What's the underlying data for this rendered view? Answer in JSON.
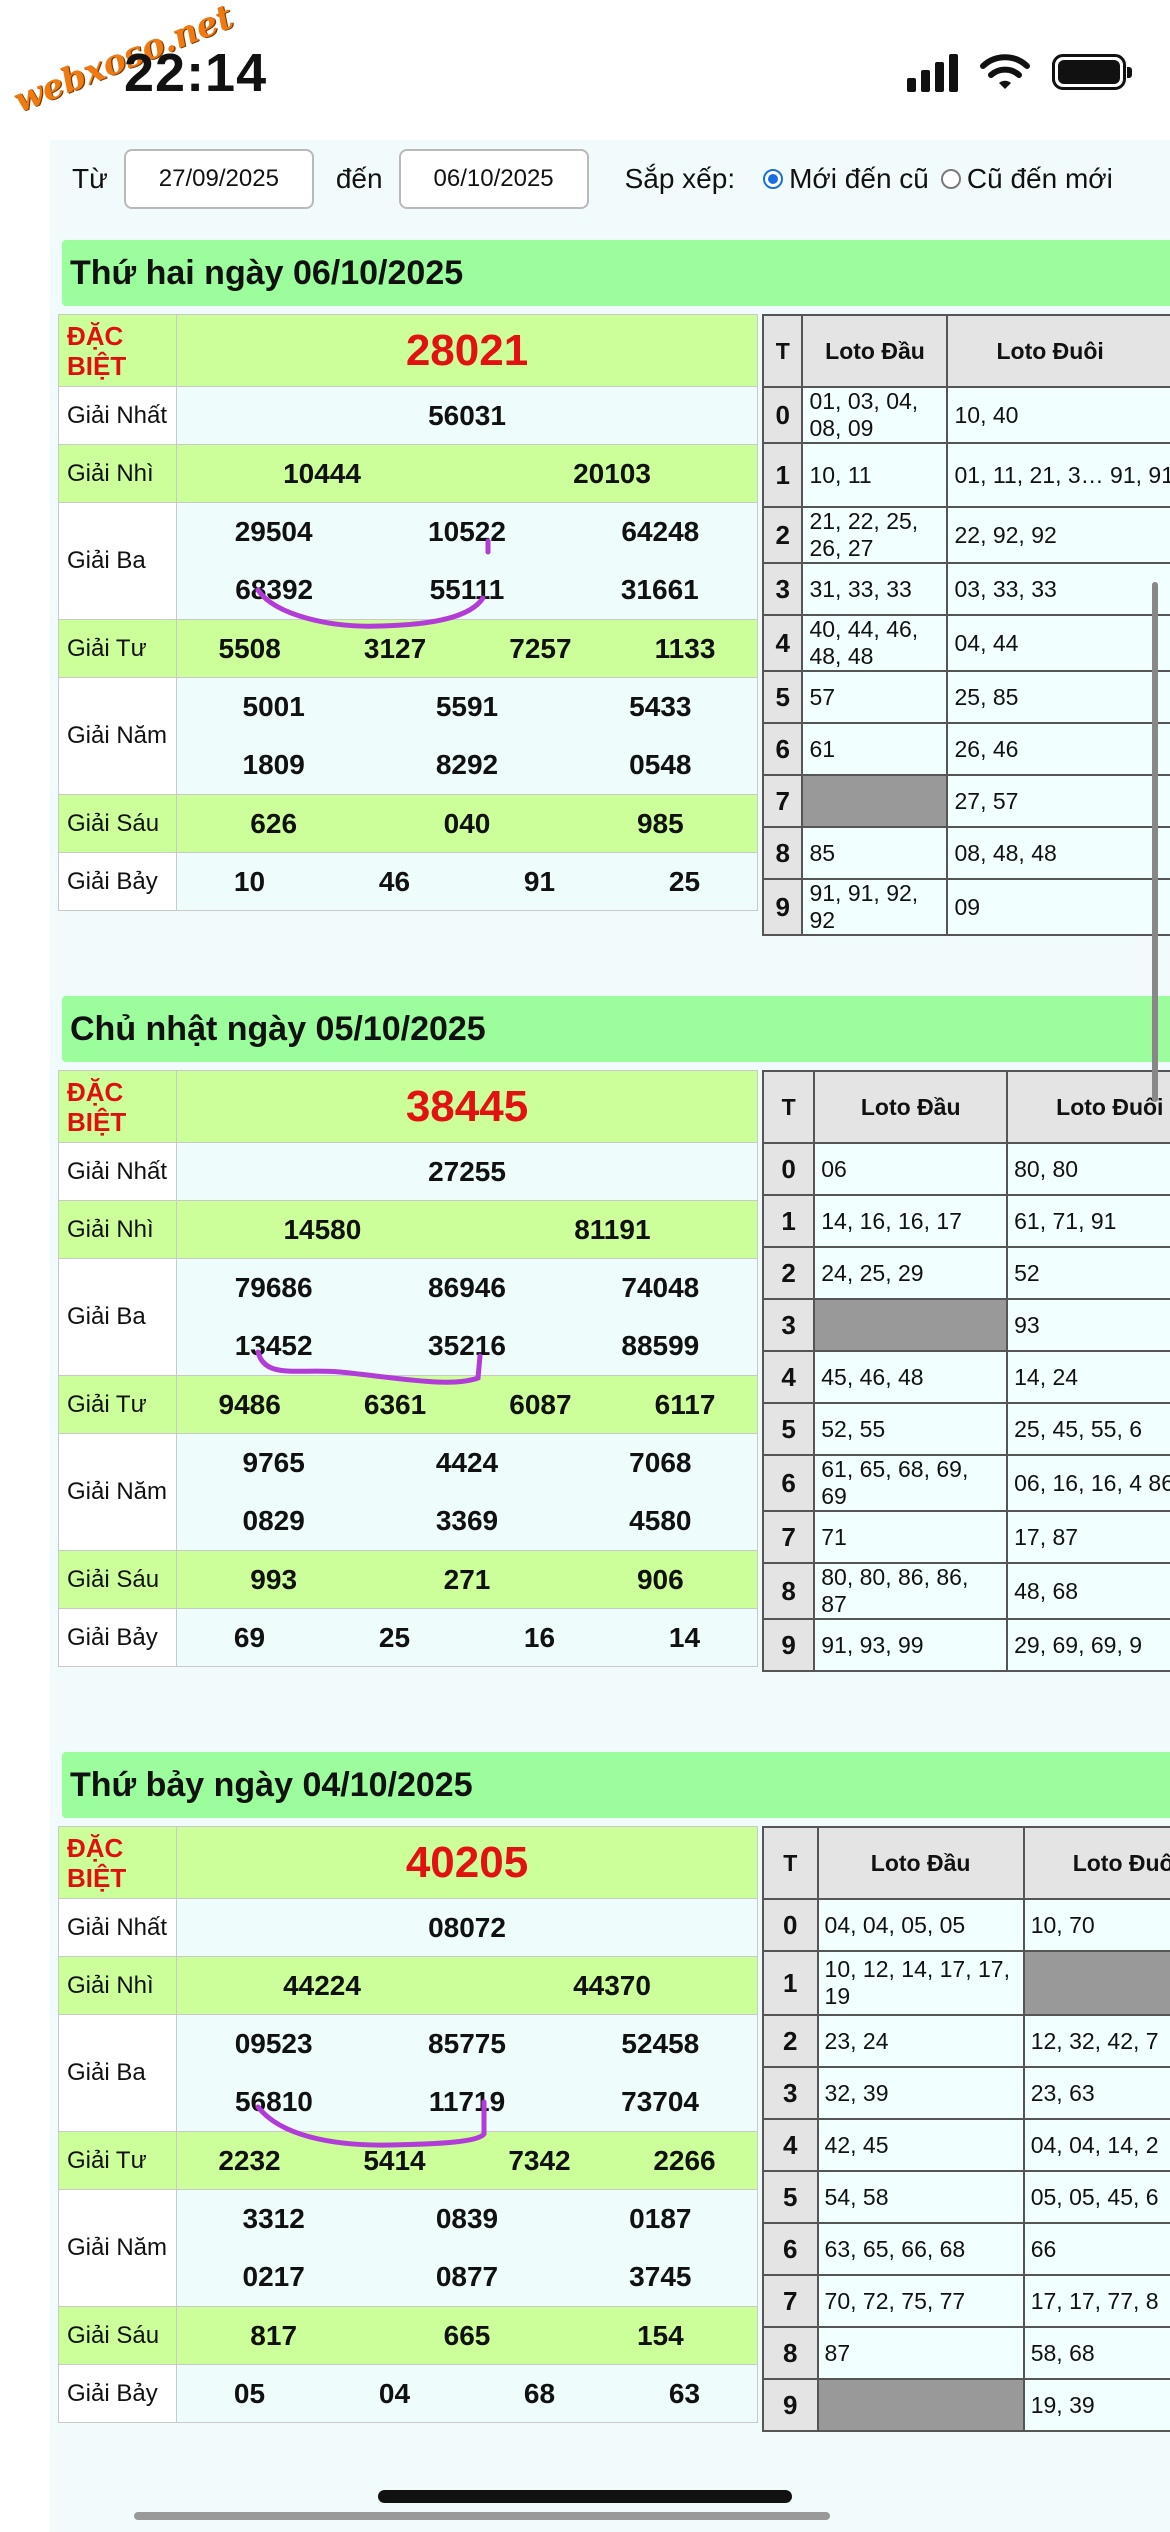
{
  "status": {
    "time": "22:14",
    "watermark": "webxoso.net"
  },
  "filter": {
    "from_label": "Từ",
    "from_value": "27/09/2025",
    "to_label": "đến",
    "to_value": "06/10/2025",
    "sort_label": "Sắp xếp:",
    "sort_options": [
      "Mới đến cũ",
      "Cũ đến mới"
    ],
    "sort_selected": "Mới đến cũ"
  },
  "loto_headers": {
    "t": "T",
    "dau": "Loto Đầu",
    "duoi": "Loto Đuôi"
  },
  "prize_labels": {
    "db": "ĐẶC BIỆT",
    "nhat": "Giải Nhất",
    "nhi": "Giải Nhì",
    "ba": "Giải Ba",
    "tu": "Giải Tư",
    "nam": "Giải Năm",
    "sau": "Giải Sáu",
    "bay": "Giải Bảy"
  },
  "days": [
    {
      "title": "Thứ hai ngày 06/10/2025",
      "db": "28021",
      "nhat": "56031",
      "nhi": [
        "10444",
        "20103"
      ],
      "ba": [
        [
          "29504",
          "10522",
          "64248"
        ],
        [
          "68392",
          "55111",
          "31661"
        ]
      ],
      "tu": [
        "5508",
        "3127",
        "7257",
        "1133"
      ],
      "nam": [
        [
          "5001",
          "5591",
          "5433"
        ],
        [
          "1809",
          "8292",
          "0548"
        ]
      ],
      "sau": [
        "626",
        "040",
        "985"
      ],
      "bay": [
        "10",
        "46",
        "91",
        "25"
      ],
      "loto": [
        [
          "0",
          "01, 03, 04, 08, 09",
          "10, 40"
        ],
        [
          "1",
          "10, 11",
          "01, 11, 21, 3… 91, 91"
        ],
        [
          "2",
          "21, 22, 25, 26, 27",
          "22, 92, 92"
        ],
        [
          "3",
          "31, 33, 33",
          "03, 33, 33"
        ],
        [
          "4",
          "40, 44, 46, 48, 48",
          "04, 44"
        ],
        [
          "5",
          "57",
          "25, 85"
        ],
        [
          "6",
          "61",
          "26, 46"
        ],
        [
          "7",
          "",
          "27, 57"
        ],
        [
          "8",
          "85",
          "08, 48, 48"
        ],
        [
          "9",
          "91, 91, 92, 92",
          "09"
        ]
      ]
    },
    {
      "title": "Chủ nhật ngày 05/10/2025",
      "db": "38445",
      "nhat": "27255",
      "nhi": [
        "14580",
        "81191"
      ],
      "ba": [
        [
          "79686",
          "86946",
          "74048"
        ],
        [
          "13452",
          "35216",
          "88599"
        ]
      ],
      "tu": [
        "9486",
        "6361",
        "6087",
        "6117"
      ],
      "nam": [
        [
          "9765",
          "4424",
          "7068"
        ],
        [
          "0829",
          "3369",
          "4580"
        ]
      ],
      "sau": [
        "993",
        "271",
        "906"
      ],
      "bay": [
        "69",
        "25",
        "16",
        "14"
      ],
      "loto": [
        [
          "0",
          "06",
          "80, 80"
        ],
        [
          "1",
          "14, 16, 16, 17",
          "61, 71, 91"
        ],
        [
          "2",
          "24, 25, 29",
          "52"
        ],
        [
          "3",
          "",
          "93"
        ],
        [
          "4",
          "45, 46, 48",
          "14, 24"
        ],
        [
          "5",
          "52, 55",
          "25, 45, 55, 6"
        ],
        [
          "6",
          "61, 65, 68, 69, 69",
          "06, 16, 16, 4 86"
        ],
        [
          "7",
          "71",
          "17, 87"
        ],
        [
          "8",
          "80, 80, 86, 86, 87",
          "48, 68"
        ],
        [
          "9",
          "91, 93, 99",
          "29, 69, 69, 9"
        ]
      ]
    },
    {
      "title": "Thứ bảy ngày 04/10/2025",
      "db": "40205",
      "nhat": "08072",
      "nhi": [
        "44224",
        "44370"
      ],
      "ba": [
        [
          "09523",
          "85775",
          "52458"
        ],
        [
          "56810",
          "11719",
          "73704"
        ]
      ],
      "tu": [
        "2232",
        "5414",
        "7342",
        "2266"
      ],
      "nam": [
        [
          "3312",
          "0839",
          "0187"
        ],
        [
          "0217",
          "0877",
          "3745"
        ]
      ],
      "sau": [
        "817",
        "665",
        "154"
      ],
      "bay": [
        "05",
        "04",
        "68",
        "63"
      ],
      "loto": [
        [
          "0",
          "04, 04, 05, 05",
          "10, 70"
        ],
        [
          "1",
          "10, 12, 14, 17, 17, 19",
          ""
        ],
        [
          "2",
          "23, 24",
          "12, 32, 42, 7"
        ],
        [
          "3",
          "32, 39",
          "23, 63"
        ],
        [
          "4",
          "42, 45",
          "04, 04, 14, 2"
        ],
        [
          "5",
          "54, 58",
          "05, 05, 45, 6"
        ],
        [
          "6",
          "63, 65, 66, 68",
          "66"
        ],
        [
          "7",
          "70, 72, 75, 77",
          "17, 17, 77, 8"
        ],
        [
          "8",
          "87",
          "58, 68"
        ],
        [
          "9",
          "",
          "19, 39"
        ]
      ]
    }
  ],
  "colors": {
    "header_green": "#9bfd9b",
    "row_green": "#ccff99",
    "special_red": "#e31212",
    "annotation_purple": "#b23cd8"
  }
}
